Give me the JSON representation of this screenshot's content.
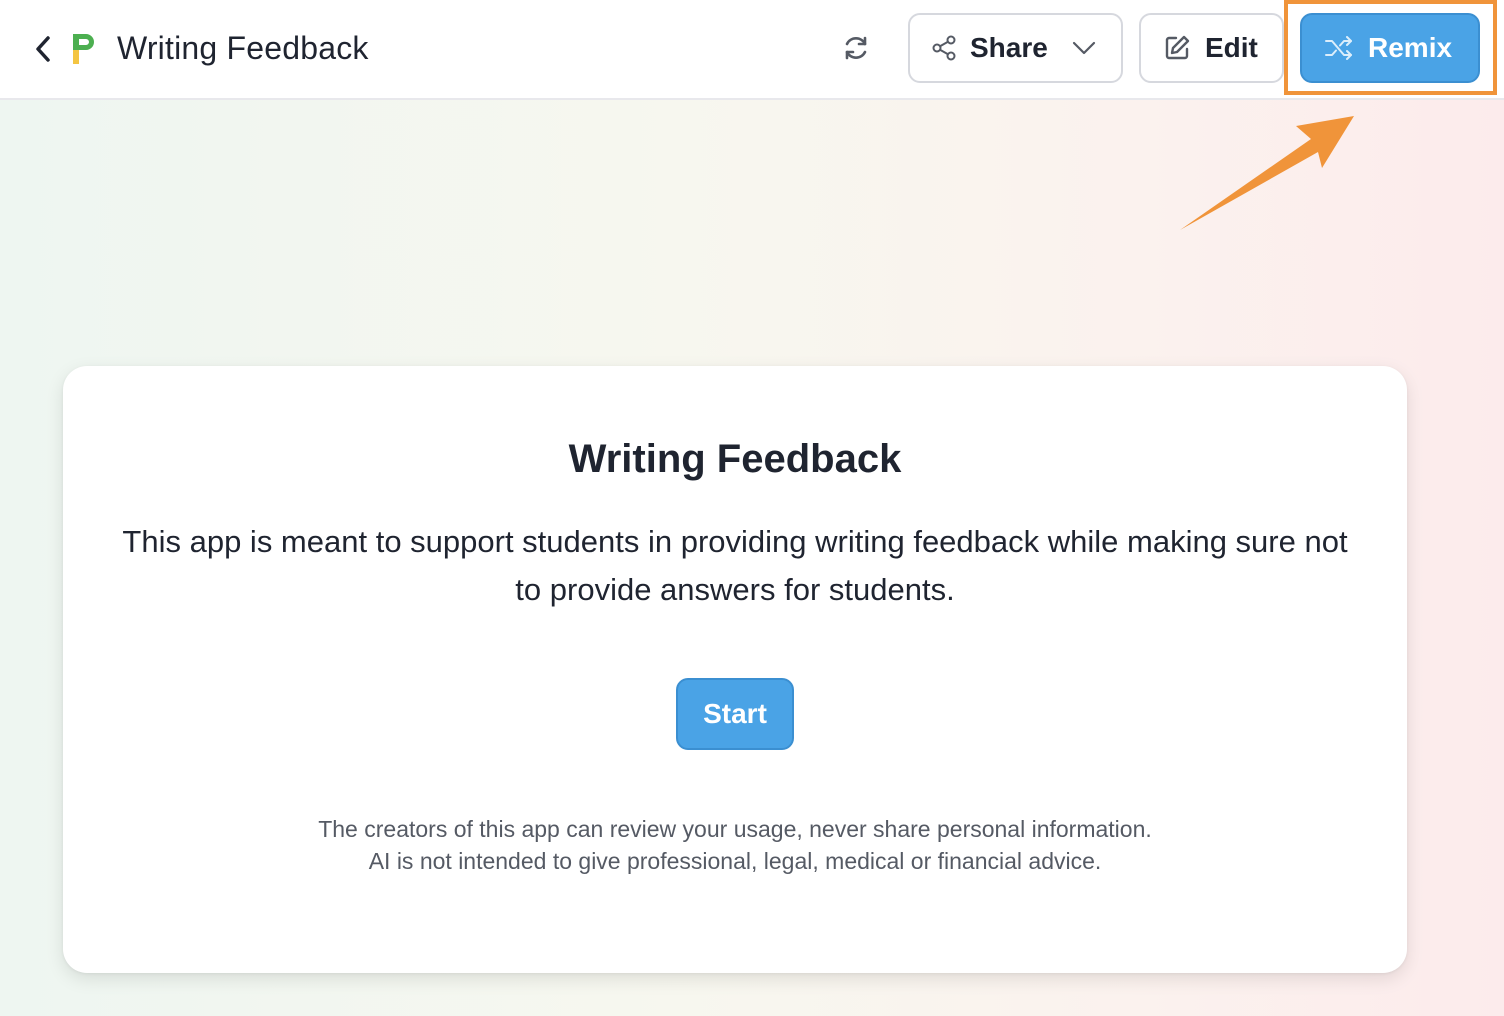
{
  "header": {
    "title": "Writing Feedback",
    "share_label": "Share",
    "edit_label": "Edit",
    "remix_label": "Remix"
  },
  "card": {
    "title": "Writing Feedback",
    "description": "This app is meant to support students in providing writing feedback while making sure not to provide answers for students.",
    "start_label": "Start",
    "disclaimer_line1": "The creators of this app can review your usage, never share personal information.",
    "disclaimer_line2": "AI is not intended to give professional, legal, medical or financial advice."
  },
  "colors": {
    "accent": "#4aa3e6",
    "highlight": "#f0943a",
    "logo_top": "#4caf50",
    "logo_bottom": "#f4c542"
  },
  "icons": [
    "chevron-left-icon",
    "logo-icon",
    "refresh-icon",
    "share-icon",
    "chevron-down-icon",
    "edit-icon",
    "shuffle-icon"
  ]
}
